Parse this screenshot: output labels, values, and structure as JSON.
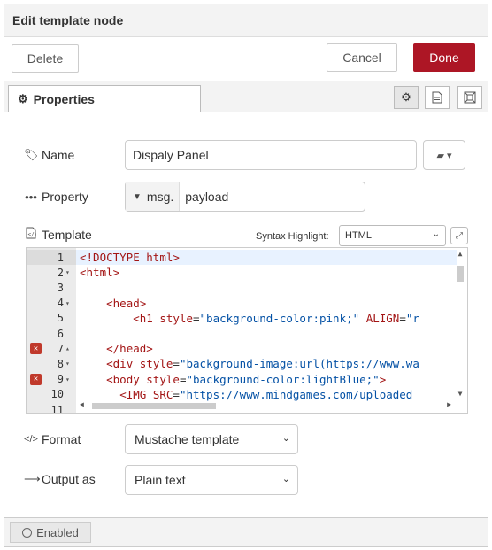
{
  "dialog": {
    "title": "Edit template node"
  },
  "toolbar": {
    "delete_label": "Delete",
    "cancel_label": "Cancel",
    "done_label": "Done"
  },
  "tabs": {
    "properties_label": "Properties"
  },
  "tab_icons": [
    "gear-icon",
    "document-icon",
    "frame-icon"
  ],
  "form": {
    "name": {
      "label": "Name",
      "value": "Dispaly Panel"
    },
    "property": {
      "label": "Property",
      "type_prefix": "msg.",
      "value": "payload"
    },
    "template": {
      "label": "Template",
      "syntax_label": "Syntax Highlight:",
      "syntax_value": "HTML",
      "lines": [
        {
          "num": "1",
          "fold": "",
          "error": false,
          "text": "<!DOCTYPE html>"
        },
        {
          "num": "2",
          "fold": "▾",
          "error": false,
          "text": "<html>"
        },
        {
          "num": "3",
          "fold": "",
          "error": false,
          "text": ""
        },
        {
          "num": "4",
          "fold": "▾",
          "error": false,
          "text": "    <head>"
        },
        {
          "num": "5",
          "fold": "",
          "error": false,
          "text": "        <h1 style=\"background-color:pink;\" ALIGN=\"r"
        },
        {
          "num": "6",
          "fold": "",
          "error": false,
          "text": ""
        },
        {
          "num": "7",
          "fold": "▴",
          "error": true,
          "text": "    </head>"
        },
        {
          "num": "8",
          "fold": "▾",
          "error": false,
          "text": "    <div style=\"background-image:url(https://www.wa"
        },
        {
          "num": "9",
          "fold": "▾",
          "error": true,
          "text": "    <body style=\"background-color:lightBlue;\">"
        },
        {
          "num": "10",
          "fold": "",
          "error": false,
          "text": "      <IMG SRC=\"https://www.mindgames.com/uploaded"
        },
        {
          "num": "11",
          "fold": "",
          "error": false,
          "text": ""
        }
      ]
    },
    "format": {
      "label": "Format",
      "value": "Mustache template"
    },
    "output": {
      "label": "Output as",
      "value": "Plain text"
    }
  },
  "footer": {
    "enabled_label": "Enabled"
  },
  "colors": {
    "done_button": "#ad1625",
    "error_marker": "#c0392b"
  }
}
